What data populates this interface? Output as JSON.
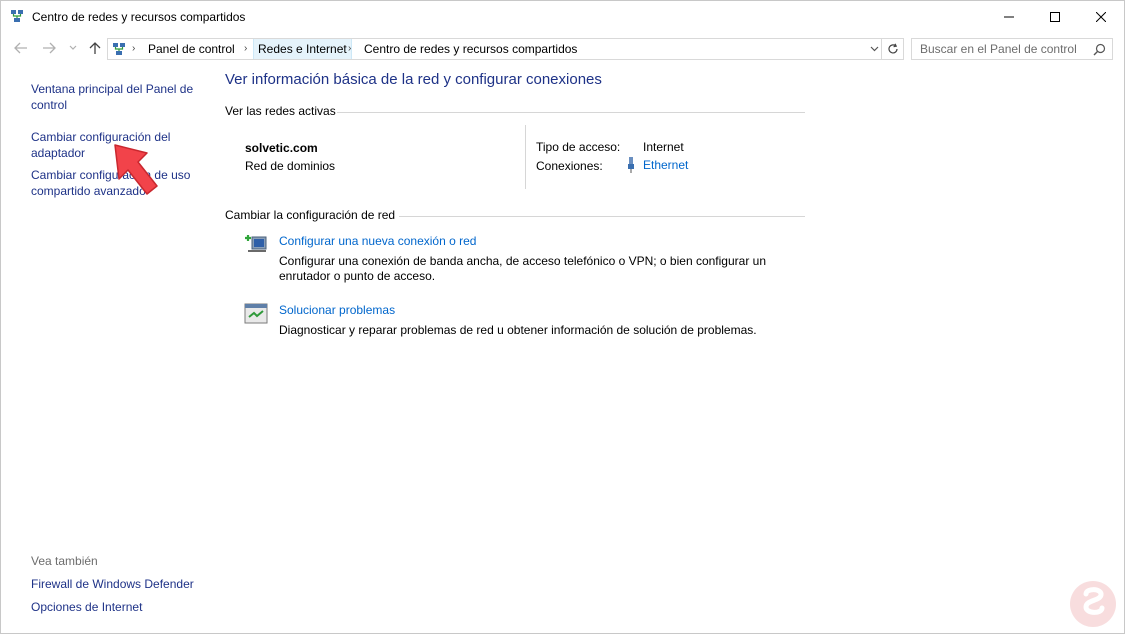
{
  "window": {
    "title": "Centro de redes y recursos compartidos"
  },
  "address_bar": {
    "crumbs": [
      "Panel de control",
      "Redes e Internet",
      "Centro de redes y recursos compartidos"
    ],
    "search_placeholder": "Buscar en el Panel de control"
  },
  "left_pane": {
    "links": [
      {
        "label": "Ventana principal del Panel de control"
      },
      {
        "label": "Cambiar configuración del adaptador"
      },
      {
        "label": "Cambiar configuración de uso compartido avanzado"
      }
    ],
    "see_also_label": "Vea también",
    "see_also": [
      {
        "label": "Firewall de Windows Defender"
      },
      {
        "label": "Opciones de Internet"
      }
    ]
  },
  "main": {
    "heading": "Ver información básica de la red y configurar conexiones",
    "active_networks": {
      "label": "Ver las redes activas",
      "network_name": "solvetic.com",
      "network_type": "Red de dominios",
      "access_type_label": "Tipo de acceso:",
      "access_type_value": "Internet",
      "connections_label": "Conexiones:",
      "connections_value": "Ethernet"
    },
    "change_settings": {
      "label": "Cambiar la configuración de red",
      "tasks": [
        {
          "title": "Configurar una nueva conexión o red",
          "desc_line1": "Configurar una conexión de banda ancha, de acceso telefónico o VPN; o bien configurar un",
          "desc_line2": "enrutador o punto de acceso.",
          "icon": "new-connection-icon"
        },
        {
          "title": "Solucionar problemas",
          "desc_line1": "Diagnosticar y reparar problemas de red u obtener información de solución de problemas.",
          "icon": "troubleshoot-icon"
        }
      ]
    }
  },
  "colors": {
    "heading": "#1e3287",
    "link": "#0066cc",
    "annotation_arrow": "#f2434a"
  }
}
